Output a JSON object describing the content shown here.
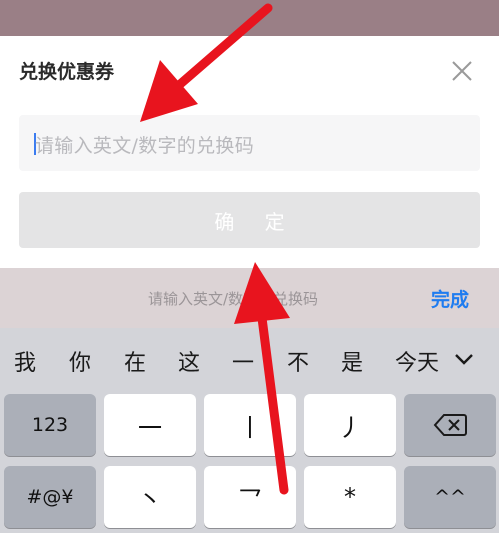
{
  "dialog": {
    "title": "兑换优惠券",
    "input_placeholder": "请输入英文/数字的兑换码",
    "confirm_label": "确 定"
  },
  "accessory_bar": {
    "hint": "请输入英文/数字的兑换码",
    "done_label": "完成"
  },
  "keyboard": {
    "candidates": [
      "我",
      "你",
      "在",
      "这",
      "一",
      "不",
      "是",
      "今天"
    ],
    "row1": {
      "numbers_key": "123",
      "stroke1": "一",
      "stroke2": "丨",
      "stroke3": "丿"
    },
    "row2": {
      "symbols_key": "#@¥",
      "stroke4": "丶",
      "stroke5": "乛",
      "wildcard": "*",
      "emoji_key": "^^"
    }
  },
  "annotations": {
    "arrow_color": "#e8141e"
  }
}
